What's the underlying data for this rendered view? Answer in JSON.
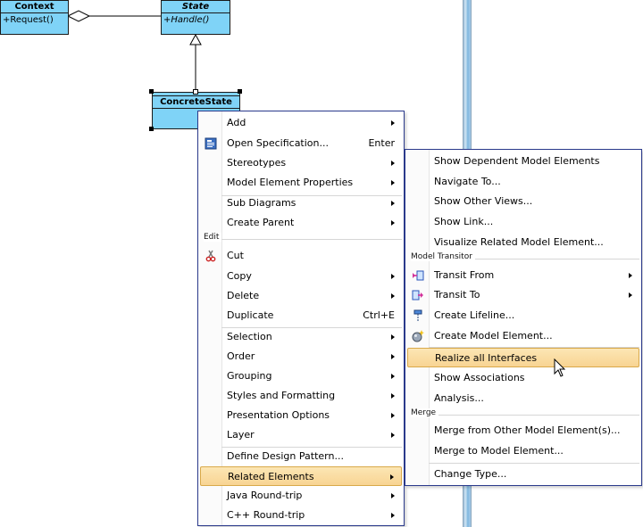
{
  "diagram": {
    "context": {
      "name": "Context",
      "operation": "+Request()"
    },
    "state": {
      "name": "State",
      "operation": "+Handle()"
    },
    "concrete": {
      "name": "ConcreteState"
    }
  },
  "context_menu": {
    "items": [
      {
        "label": "Add",
        "submenu": true
      },
      {
        "label": "Open Specification...",
        "shortcut": "Enter",
        "icon": "specification-icon"
      },
      {
        "label": "Stereotypes",
        "submenu": true
      },
      {
        "label": "Model Element Properties",
        "submenu": true
      },
      {
        "label": "Sub Diagrams",
        "submenu": true
      },
      {
        "label": "Create Parent",
        "submenu": true
      },
      {
        "label": "Cut",
        "icon": "scissors-icon"
      },
      {
        "label": "Copy",
        "submenu": true
      },
      {
        "label": "Delete",
        "submenu": true
      },
      {
        "label": "Duplicate",
        "shortcut": "Ctrl+E"
      },
      {
        "label": "Selection",
        "submenu": true
      },
      {
        "label": "Order",
        "submenu": true
      },
      {
        "label": "Grouping",
        "submenu": true
      },
      {
        "label": "Styles and Formatting",
        "submenu": true
      },
      {
        "label": "Presentation Options",
        "submenu": true
      },
      {
        "label": "Layer",
        "submenu": true
      },
      {
        "label": "Define Design Pattern..."
      },
      {
        "label": "Related Elements",
        "submenu": true,
        "highlighted": true
      },
      {
        "label": "Java Round-trip",
        "submenu": true
      },
      {
        "label": "C++ Round-trip",
        "submenu": true
      }
    ],
    "edit_section": "Edit"
  },
  "submenu": {
    "items": [
      {
        "label": "Show Dependent Model Elements"
      },
      {
        "label": "Navigate To..."
      },
      {
        "label": "Show Other Views..."
      },
      {
        "label": "Show Link..."
      },
      {
        "label": "Visualize Related Model Element..."
      },
      {
        "label": "Transit From",
        "submenu": true,
        "icon": "transit-from-icon"
      },
      {
        "label": "Transit To",
        "submenu": true,
        "icon": "transit-to-icon"
      },
      {
        "label": "Create Lifeline...",
        "icon": "lifeline-icon"
      },
      {
        "label": "Create Model Element...",
        "icon": "model-element-icon"
      },
      {
        "label": "Realize all Interfaces",
        "highlighted": true
      },
      {
        "label": "Show Associations"
      },
      {
        "label": "Analysis..."
      },
      {
        "label": "Merge from Other Model Element(s)..."
      },
      {
        "label": "Merge to Model Element..."
      },
      {
        "label": "Change Type..."
      }
    ],
    "transitor_section": "Model Transitor",
    "merge_section": "Merge"
  },
  "colors": {
    "class_fill": "#7fd3f7",
    "menu_border": "#2b3a8c",
    "highlight": "#f8d493"
  }
}
